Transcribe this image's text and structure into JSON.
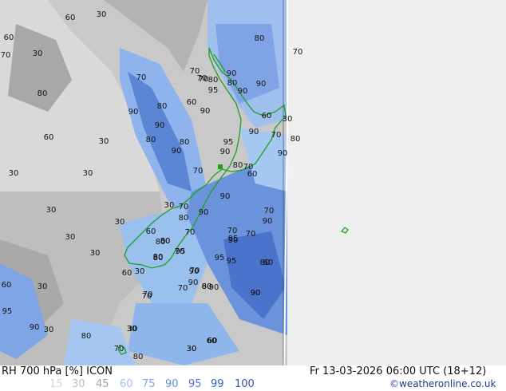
{
  "title": "RH 700 hPa [%] ICON",
  "valid_time": "Fr 13-03-2026 06:00 UTC (18+12)",
  "credit": "©weatheronline.co.uk",
  "legend": {
    "values": [
      "15",
      "30",
      "45",
      "60",
      "75",
      "90",
      "95",
      "99",
      "100"
    ],
    "colors": [
      "#d6d6d6",
      "#bdbdbd",
      "#a3a3a3",
      "#9fc3f0",
      "#7fa7e8",
      "#5f8fdd",
      "#4a78d2",
      "#3562c5",
      "#2b53b8"
    ]
  },
  "contour_labels": [
    "60",
    "30",
    "60",
    "70",
    "30",
    "80",
    "60",
    "30",
    "30",
    "30",
    "30",
    "30",
    "30",
    "30",
    "60",
    "30",
    "95",
    "90",
    "30",
    "80",
    "70",
    "80",
    "30",
    "30",
    "60",
    "70",
    "90",
    "80",
    "90",
    "80",
    "95",
    "70",
    "80",
    "60",
    "80",
    "70",
    "30",
    "70",
    "80",
    "90",
    "80",
    "95",
    "90",
    "70",
    "90",
    "80",
    "90",
    "70",
    "80",
    "90",
    "70",
    "80",
    "70",
    "90",
    "95",
    "95",
    "90",
    "80",
    "90",
    "70",
    "60",
    "60",
    "70",
    "90",
    "80",
    "60",
    "90",
    "70",
    "70",
    "70",
    "90",
    "95",
    "80",
    "90",
    "80",
    "90",
    "70",
    "90",
    "80",
    "30",
    "60",
    "30",
    "70",
    "60",
    "80",
    "80",
    "70",
    "90",
    "60",
    "70",
    "70",
    "90",
    "95",
    "90",
    "30",
    "60",
    "30"
  ]
}
